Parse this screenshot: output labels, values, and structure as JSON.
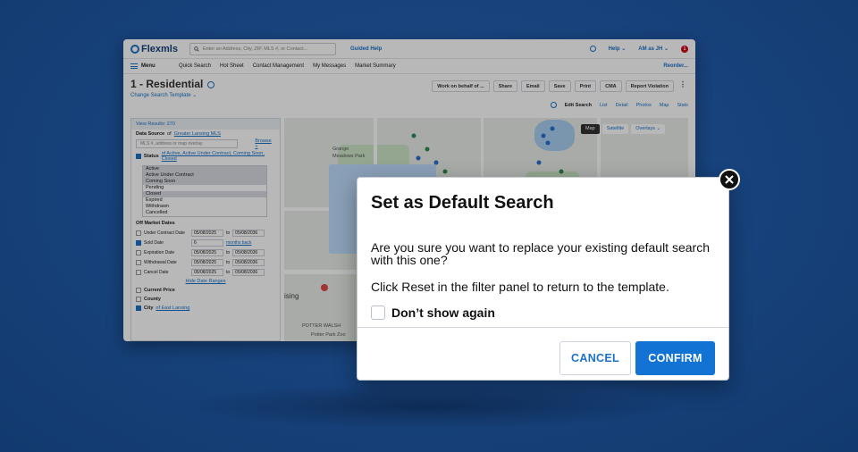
{
  "app": {
    "logo": "Flexmls",
    "search_placeholder": "Enter an Address, City, ZIP, MLS #, or Contact...",
    "guided_help": "Guided Help",
    "help": "Help",
    "user": "AM as JH",
    "notification_count": "1"
  },
  "nav": {
    "menu": "Menu",
    "items": [
      "Quick Search",
      "Hot Sheet",
      "Contact Management",
      "My Messages",
      "Market Summary"
    ],
    "reorder": "Reorder..."
  },
  "header": {
    "title": "1 - Residential",
    "subtitle": "Change Search Template",
    "actions": [
      "Work on behalf of ...",
      "Share",
      "Email",
      "Save",
      "Print",
      "CMA",
      "Report Violation"
    ]
  },
  "view_tabs": [
    "Edit Search",
    "List",
    "Detail",
    "Photos",
    "Map",
    "Stats"
  ],
  "filter_panel": {
    "view_results": "View Results: 270",
    "data_source_label": "Data Source",
    "data_source_of": "of",
    "data_source_value": "Greater Lansing MLS",
    "mls_placeholder": "MLS #, address or map overlay",
    "browse": "Browse »",
    "status_label": "Status",
    "status_value": "of Active, Active Under Contract, Coming Soon, Closed",
    "status_options": [
      "Active",
      "Active Under Contract",
      "Coming Soon",
      "Pending",
      "Closed",
      "Expired",
      "Withdrawn",
      "Cancelled"
    ],
    "off_market_dates": "Off Market Dates",
    "dates": [
      {
        "label": "Under Contract Date",
        "from": "05/08/2025",
        "to": "05/08/2036"
      },
      {
        "label": "Sold Date",
        "from": "6",
        "to": "months back"
      },
      {
        "label": "Expiration Date",
        "from": "05/08/2025",
        "to": "05/08/2036"
      },
      {
        "label": "Withdrawal Date",
        "from": "05/08/2025",
        "to": "05/08/2036"
      },
      {
        "label": "Cancel Date",
        "from": "05/08/2025",
        "to": "05/08/2036"
      }
    ],
    "to_word": "to",
    "hide_date_ranges": "Hide Date Ranges",
    "current_price": "Current Price",
    "county": "County",
    "city_label": "City",
    "city_value": "of East Lansing",
    "city_chip": "East Lansing"
  },
  "map": {
    "map_btn": "Map",
    "satellite_btn": "Satellite",
    "overlays_btn": "Overlays",
    "labels": [
      "Grange",
      "Meadows Park",
      "POTTER WALSH",
      "Potter Park Zoo",
      "ising"
    ]
  },
  "modal": {
    "title": "Set as Default Search",
    "question": "Are you sure you want to replace your existing default search with this one?",
    "hint": "Click Reset in the filter panel to return to the template.",
    "dont_show": "Don’t show again",
    "cancel": "CANCEL",
    "confirm": "CONFIRM"
  },
  "colors": {
    "background": "#17417a",
    "accent": "#1273d4",
    "link": "#1b72c9"
  }
}
